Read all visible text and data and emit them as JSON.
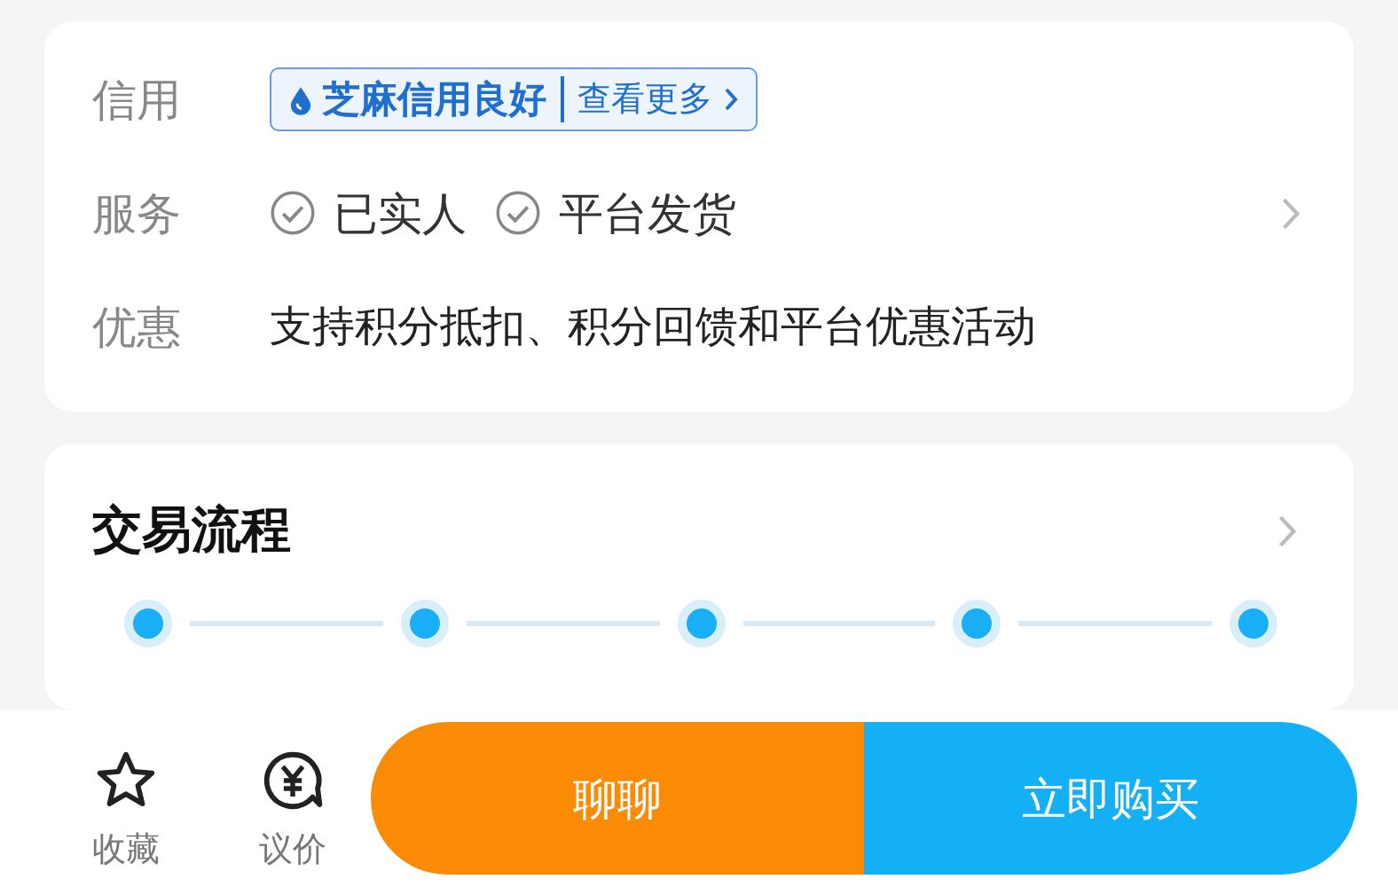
{
  "info_card": {
    "rows": [
      {
        "kind": "credit",
        "label": "信用",
        "badge": {
          "title": "芝麻信用良好",
          "link": "查看更多"
        }
      },
      {
        "kind": "tags",
        "label": "服务",
        "tags": [
          "已实人",
          "平台发货"
        ],
        "has_chevron": true
      },
      {
        "kind": "text",
        "label": "优惠",
        "text": "支持积分抵扣、积分回馈和平台优惠活动"
      }
    ]
  },
  "process_card": {
    "title": "交易流程",
    "has_chevron": true,
    "steps": [
      {
        "kind": "dot"
      },
      {
        "kind": "dot"
      },
      {
        "kind": "dot"
      },
      {
        "kind": "dot"
      },
      {
        "kind": "dot"
      }
    ]
  },
  "bottom_bar": {
    "actions": [
      {
        "kind": "star",
        "label": "收藏"
      },
      {
        "kind": "price",
        "label": "议价"
      }
    ],
    "buttons": [
      {
        "kind": "chat",
        "label": "聊聊"
      },
      {
        "kind": "buy",
        "label": "立即购买"
      }
    ]
  }
}
